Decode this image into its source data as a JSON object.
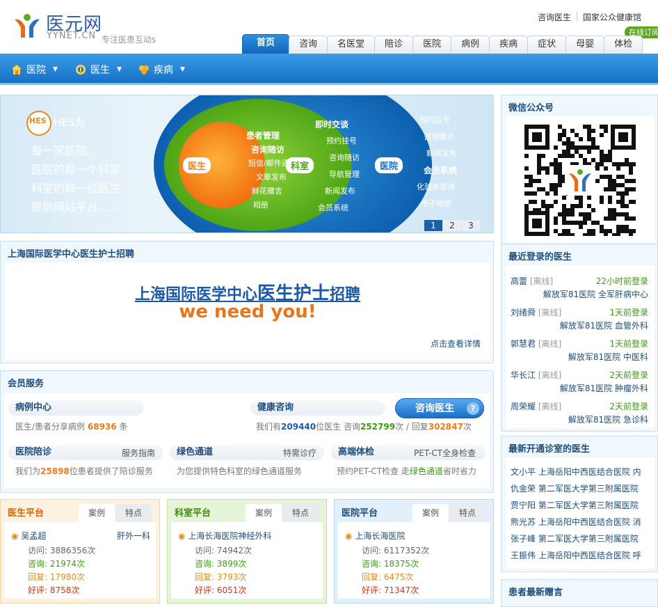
{
  "header": {
    "logo_cn": "医元网",
    "logo_en": "YYNET.CN",
    "slogan": "专注医患互动s",
    "top_links": [
      "咨询医生",
      "国家公众健康馆"
    ],
    "online_badge": "在线订阅"
  },
  "tabs": [
    "首页",
    "咨询",
    "名医堂",
    "陪诊",
    "医院",
    "病例",
    "疾病",
    "症状",
    "母婴",
    "体检"
  ],
  "navbar": [
    {
      "label": "医院",
      "icon": "house-icon"
    },
    {
      "label": "医生",
      "icon": "doctor-icon"
    },
    {
      "label": "疾病",
      "icon": "virus-icon"
    }
  ],
  "banner": {
    "logo": "HES",
    "logo_suffix": "HES为",
    "lines": [
      "每一家医院,",
      "医院的每一个科室,",
      "科室的每一位医生,",
      "提供网站平台……"
    ],
    "doctor_label": "医生",
    "doctor_items": [
      "患者管理",
      "咨询随访",
      "短信/邮件通知",
      "文章发布",
      "鲜花赠言",
      "相册"
    ],
    "dept_label": "科室",
    "dept_items": [
      "即时交谈",
      "预约挂号",
      "咨询随访",
      "导航管理",
      "新闻发布",
      "会员系统"
    ],
    "hosp_label": "医院",
    "hosp_items": [
      "预约挂号",
      "咨询随访",
      "新闻发布",
      "会员系统",
      "化验单查询",
      "电子地图"
    ],
    "slides": [
      "1",
      "2",
      "3"
    ]
  },
  "recruit": {
    "title": "上海国际医学中心医生护士招聘",
    "headline_pre": "上海国际医学中心",
    "headline_big": "医生护士",
    "headline_post": "招聘",
    "sub": "we need you!",
    "detail_link": "点击查看详情"
  },
  "member": {
    "title": "会员服务",
    "case_center": "病例中心",
    "case_text_pre": "医生/患者分享病例",
    "case_count": "68936",
    "case_text_post": "条",
    "health_consult": "健康咨询",
    "consult_pre": "我们有",
    "consult_doctors": "209440",
    "consult_mid": "位医生 咨询",
    "consult_count": "252799",
    "consult_mid2": "次 / 回复",
    "reply_count": "302847",
    "consult_post": "次",
    "consult_button": "咨询医生",
    "help_glyph": "?",
    "escort": "医院陪诊",
    "escort_tag": "服务指南",
    "escort_pre": "我们为",
    "escort_count": "25898",
    "escort_post": "位患者提供了陪诊服务",
    "green": "绿色通道",
    "green_tag": "特需诊疗",
    "green_text": "为您提供特色科室的绿色通道服务",
    "checkup": "高端体检",
    "checkup_tag": "PET-CT全身检查",
    "checkup_pre": "预约PET-CT检查 走",
    "checkup_mid": "绿色通道",
    "checkup_post": "省时省力"
  },
  "platforms": [
    {
      "title": "医生平台",
      "tabs": [
        "案例",
        "特点"
      ],
      "name": "吴孟超",
      "extra": "肝外一科",
      "visits_label": "访问: ",
      "visits": "3886356次",
      "consult_label": "咨询: ",
      "consult": "21974次",
      "reply_label": "回复: ",
      "reply": "17980次",
      "praise_label": "好评: ",
      "praise": "8758次"
    },
    {
      "title": "科室平台",
      "tabs": [
        "案例",
        "特点"
      ],
      "name": "上海长海医院神经外科",
      "extra": "",
      "visits_label": "访问: ",
      "visits": "74942次",
      "consult_label": "咨询: ",
      "consult": "3899次",
      "reply_label": "回复: ",
      "reply": "3793次",
      "praise_label": "好评: ",
      "praise": "6051次"
    },
    {
      "title": "医院平台",
      "tabs": [
        "案例",
        "特点"
      ],
      "name": "上海长海医院",
      "extra": "",
      "visits_label": "访问: ",
      "visits": "6117352次",
      "consult_label": "咨询: ",
      "consult": "18375次",
      "reply_label": "回复: ",
      "reply": "6475次",
      "praise_label": "好评: ",
      "praise": "71347次"
    }
  ],
  "sidebar": {
    "wechat_title": "微信公众号",
    "recent_title": "最近登录的医生",
    "recent": [
      {
        "name": "高蕾",
        "status": "[离线]",
        "time": "22小时前登录",
        "hospital": "解放军81医院 全军肝病中心"
      },
      {
        "name": "刘绪舜",
        "status": "[离线]",
        "time": "1天前登录",
        "hospital": "解放军81医院 血管外科"
      },
      {
        "name": "郭慧君",
        "status": "[离线]",
        "time": "1天前登录",
        "hospital": "解放军81医院 中医科"
      },
      {
        "name": "华长江",
        "status": "[离线]",
        "time": "2天前登录",
        "hospital": "解放军81医院 肿瘤外科"
      },
      {
        "name": "周荣耀",
        "status": "[离线]",
        "time": "2天前登录",
        "hospital": "解放军81医院 急诊科"
      }
    ],
    "newclinic_title": "最新开通诊室的医生",
    "newclinic": [
      {
        "name": "文小平",
        "hospital": "上海岳阳中西医结合医院 内"
      },
      {
        "name": "仇金荣",
        "hospital": "第二军医大学第三附属医院"
      },
      {
        "name": "贾宁阳",
        "hospital": "第二军医大学第三附属医院"
      },
      {
        "name": "熊光苏",
        "hospital": "上海岳阳中西医结合医院 消"
      },
      {
        "name": "张子峰",
        "hospital": "第二军医大学第三附属医院"
      },
      {
        "name": "王振伟",
        "hospital": "上海岳阳中西医结合医院 呼"
      }
    ],
    "gift_title": "患者最新赠言"
  },
  "colors": {
    "brand_blue": "#1670c4",
    "accent_orange": "#ee7a1b",
    "accent_green": "#3d9b12"
  }
}
